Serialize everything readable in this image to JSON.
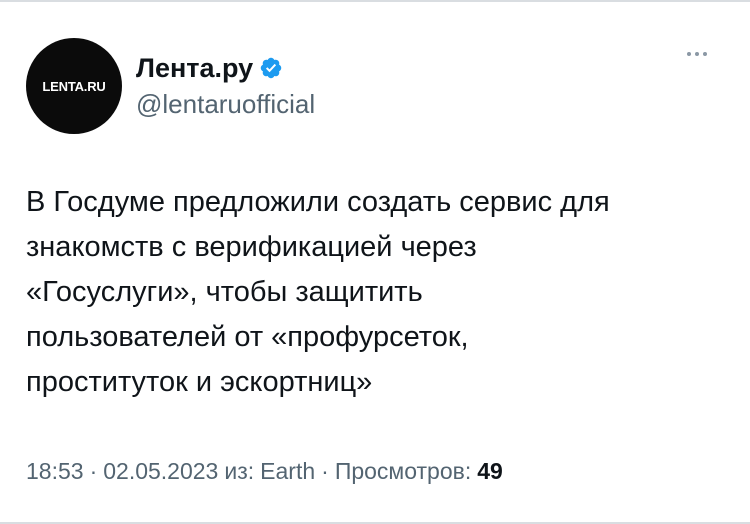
{
  "author": {
    "display_name": "Лента.ру",
    "handle": "@lentaruofficial",
    "avatar_logo_text": "LENTA.RU",
    "verified": true,
    "verified_color": "#1d9bf0"
  },
  "tweet": {
    "text": "В Госдуме предложили создать сервис для\nзнакомств с верификацией через\n«Госуслуги», чтобы защитить\nпользователей от «профурсеток,\nпроституток и эскортниц»"
  },
  "meta": {
    "time": "18:53",
    "separator": "·",
    "date": "02.05.2023",
    "source_prefix": "из:",
    "source": "Earth",
    "views_label": "Просмотров:",
    "views_count": "49"
  },
  "icons": {
    "verified": "verified-badge-icon",
    "more": "more-dots-icon"
  }
}
